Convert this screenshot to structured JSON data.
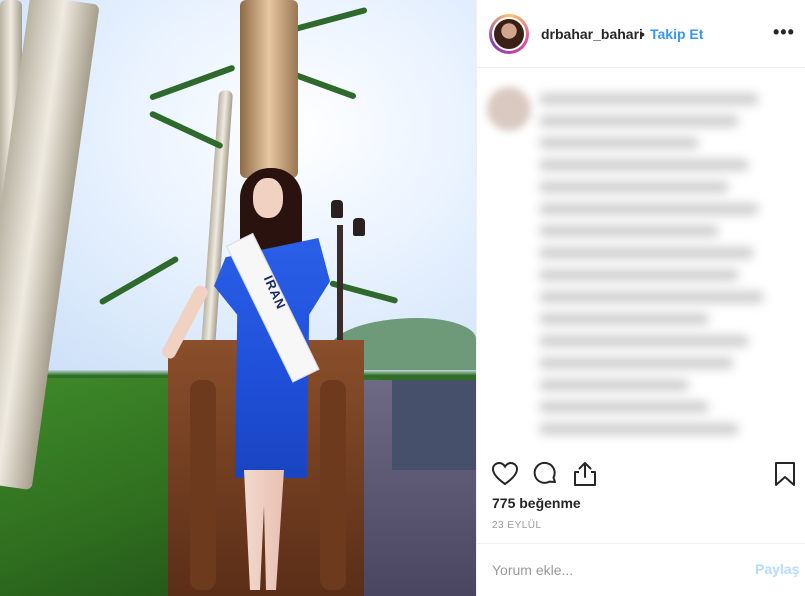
{
  "post": {
    "image_alt": "Woman in blue dress wearing IRAN sash near palm trees",
    "sash_text": "IRAN"
  },
  "header": {
    "username": "drbahar_bahari",
    "separator": "•",
    "follow_label": "Takip Et",
    "more_label": "•••"
  },
  "engagement": {
    "likes_text": "775 beğenme",
    "date_text": "23 EYLÜL"
  },
  "comment_box": {
    "placeholder": "Yorum ekle...",
    "post_label": "Paylaş"
  },
  "icons": {
    "like": "heart-icon",
    "comment": "comment-icon",
    "share": "share-icon",
    "save": "bookmark-icon",
    "more": "more-options-icon"
  },
  "colors": {
    "follow": "#3897f0",
    "post_disabled": "#b3dbff",
    "text": "#262626",
    "muted": "#999999"
  }
}
